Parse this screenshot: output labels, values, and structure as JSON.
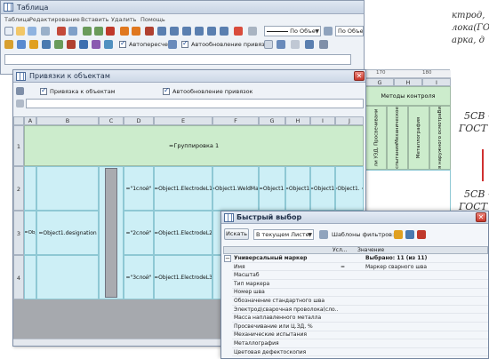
{
  "background_doc": {
    "lines": [
      "ктрод,",
      "лока(ГО",
      "арка, д"
    ],
    "labels": [
      "5СВ –",
      "ГОСТ 2",
      "5СВ –",
      "ГОСТ 2"
    ]
  },
  "main_window": {
    "title": "Таблица",
    "menu": [
      "Таблица",
      "Редактирование",
      "Вставить",
      "Удалить",
      "Помощь"
    ],
    "line_combo": "По Объе",
    "obj_combo": "По Объекту",
    "cb_autorecalc": "Автопересчет",
    "cb_autoupdate": "Автообновление привязок",
    "rows_hint": "",
    "right_grid": {
      "cols": [
        "G",
        "H",
        "I"
      ],
      "header": "Методы контроля",
      "vertical": [
        "ли УЗД, Просвечивани",
        "спытанияМеханическое",
        "Металлография",
        "я наружного осмотраВи"
      ],
      "ruler": [
        "170",
        "180"
      ]
    }
  },
  "bind_window": {
    "title": "Привязки к объектам",
    "cb_bind": "Привязка к объектам",
    "cb_auto": "Автообновление привязок",
    "cols": [
      "A",
      "B",
      "C",
      "D",
      "E",
      "F",
      "G",
      "H",
      "I",
      "J"
    ],
    "rows": [
      "1",
      "2",
      "3",
      "4"
    ],
    "group_label": "=Группировка 1",
    "row2": [
      "=\"1слой\"",
      "=Object1.ElectrodeL1",
      "=Object1.WeldMat",
      "=Object1.",
      "=Object1.",
      "=Object1.",
      "=Object1. ="
    ],
    "row3_a": "=Obj",
    "row3_b": "=Object1.designation",
    "row3": [
      "=\"2слой\"",
      "=Object1.ElectrodeL2"
    ],
    "row4": [
      "=\"3слой\"",
      "=Object1.ElectrodeL3"
    ]
  },
  "quick_select": {
    "title": "Быстрый выбор",
    "search": "Искать",
    "scope": "В текущем Листе",
    "templates": "Шаблоны фильтров:",
    "headers": [
      "Усл...",
      "Значение"
    ],
    "rows": [
      {
        "name": "Универсальный маркер",
        "cond": "",
        "value": "Выбрано: 11 (из 11)",
        "bold": true
      },
      {
        "name": "Имя",
        "cond": "=",
        "value": "Маркер сварного шва",
        "bold": false
      },
      {
        "name": "Масштаб",
        "cond": "",
        "value": "",
        "bold": false
      },
      {
        "name": "Тип маркера",
        "cond": "",
        "value": "",
        "bold": false
      },
      {
        "name": "Номер шва",
        "cond": "",
        "value": "",
        "bold": false
      },
      {
        "name": "Обозначение  стандартного шва",
        "cond": "",
        "value": "",
        "bold": false
      },
      {
        "name": "Электрод\\сварочная проволока(сло...",
        "cond": "",
        "value": "",
        "bold": false
      },
      {
        "name": "Масса наплавленного металла",
        "cond": "",
        "value": "",
        "bold": false
      },
      {
        "name": "Просвечивание или Ц.ЗД, %",
        "cond": "",
        "value": "",
        "bold": false
      },
      {
        "name": "Механические испытания",
        "cond": "",
        "value": "",
        "bold": false
      },
      {
        "name": "Металлография",
        "cond": "",
        "value": "",
        "bold": false
      },
      {
        "name": "Цветовая дефектоскопия",
        "cond": "",
        "value": "",
        "bold": false
      }
    ]
  }
}
